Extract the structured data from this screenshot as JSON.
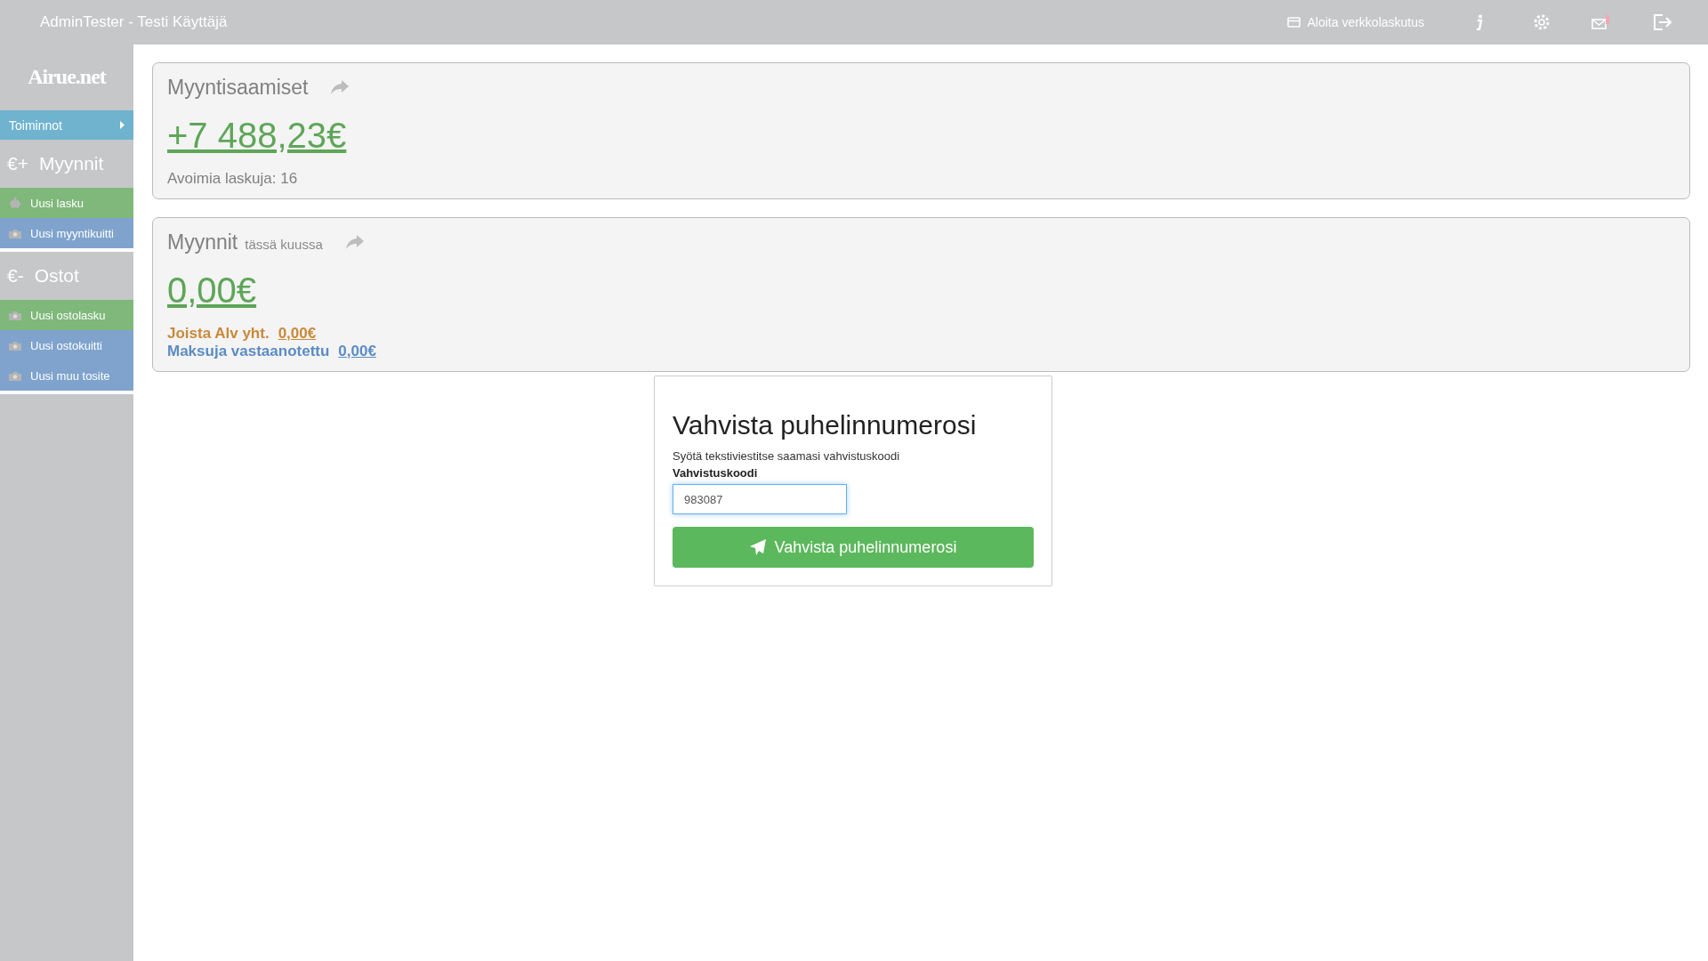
{
  "header": {
    "title": "AdminTester - Testi Käyttäjä",
    "actions": [
      {
        "kind": "card",
        "label": "Aloita verkkolaskutus"
      },
      {
        "kind": "info"
      },
      {
        "kind": "settings"
      },
      {
        "kind": "mail"
      },
      {
        "kind": "logout"
      }
    ]
  },
  "sidebar": {
    "logo": "Airue.net",
    "toggle": "Toiminnot",
    "sections": [
      {
        "symbol": "€+",
        "title": "Myynnit",
        "items": [
          {
            "label": "Uusi lasku",
            "kind": "piggy",
            "color": "#7fb87a"
          },
          {
            "label": "Uusi myyntikuitti",
            "kind": "camera",
            "color": "#7fa3cc"
          }
        ]
      },
      {
        "symbol": "€-",
        "title": "Ostot",
        "items": [
          {
            "label": "Uusi ostolasku",
            "kind": "camera",
            "color": "#7fb87a"
          },
          {
            "label": "Uusi ostokuitti",
            "kind": "camera",
            "color": "#7fa3cc"
          },
          {
            "label": "Uusi muu tosite",
            "kind": "camera",
            "color": "#7fa3cc"
          }
        ]
      }
    ]
  },
  "cards": [
    {
      "title": "Myyntisaamiset",
      "amount": "+7 488,23€",
      "note": "Avoimia laskuja: 16"
    },
    {
      "title": "Myynnit",
      "subtitle": "tässä kuussa",
      "amount": "0,00€",
      "lines": [
        {
          "label": "Joista Alv yht.",
          "value": "0,00€",
          "color": "#c98a3a"
        },
        {
          "label": "Maksuja vastaanotettu",
          "value": "0,00€",
          "color": "#5b8cc4"
        }
      ]
    }
  ],
  "dialog": {
    "title": "Vahvista puhelinnumerosi",
    "hint": "Syötä tekstiviestitse saamasi vahvistuskoodi",
    "field_label": "Vahvistuskoodi",
    "value": "983087",
    "button": "Vahvista puhelinnumerosi"
  }
}
